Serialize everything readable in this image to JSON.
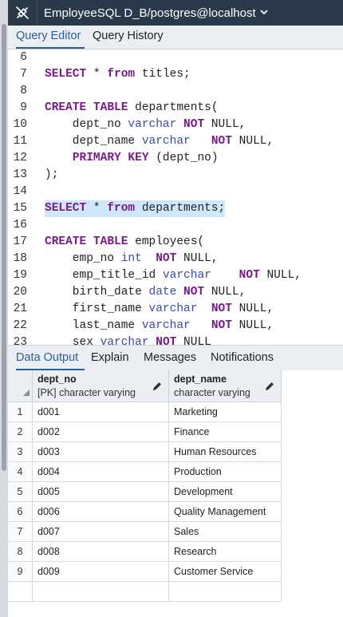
{
  "titlebar": {
    "title": "EmployeeSQL D_B/postgres@localhost",
    "connection_icon": "disconnected-plug-icon",
    "dropdown_icon": "chevron-down-icon"
  },
  "editor_tabs": [
    {
      "label": "Query Editor",
      "active": true
    },
    {
      "label": "Query History",
      "active": false
    }
  ],
  "editor": {
    "highlight_line": 15,
    "lines": [
      {
        "num": "6",
        "segs": []
      },
      {
        "num": "7",
        "segs": [
          [
            "kw",
            "SELECT"
          ],
          [
            "t",
            " * "
          ],
          [
            "kw",
            "from"
          ],
          [
            "t",
            " titles;"
          ]
        ]
      },
      {
        "num": "8",
        "segs": []
      },
      {
        "num": "9",
        "segs": [
          [
            "kw",
            "CREATE TABLE"
          ],
          [
            "t",
            " departments("
          ]
        ]
      },
      {
        "num": "10",
        "segs": [
          [
            "t",
            "    dept_no "
          ],
          [
            "ty",
            "varchar"
          ],
          [
            "t",
            " "
          ],
          [
            "kw",
            "NOT"
          ],
          [
            "t",
            " NULL,"
          ]
        ]
      },
      {
        "num": "11",
        "segs": [
          [
            "t",
            "    dept_name "
          ],
          [
            "ty",
            "varchar"
          ],
          [
            "t",
            "   "
          ],
          [
            "kw",
            "NOT"
          ],
          [
            "t",
            " NULL,"
          ]
        ]
      },
      {
        "num": "12",
        "segs": [
          [
            "t",
            "    "
          ],
          [
            "kw",
            "PRIMARY KEY"
          ],
          [
            "t",
            " (dept_no)"
          ]
        ]
      },
      {
        "num": "13",
        "segs": [
          [
            "t",
            ");"
          ]
        ]
      },
      {
        "num": "14",
        "segs": []
      },
      {
        "num": "15",
        "segs": [
          [
            "kw",
            "SELECT"
          ],
          [
            "t",
            " * "
          ],
          [
            "kw",
            "from"
          ],
          [
            "t",
            " departments;"
          ]
        ]
      },
      {
        "num": "16",
        "segs": []
      },
      {
        "num": "17",
        "segs": [
          [
            "kw",
            "CREATE TABLE"
          ],
          [
            "t",
            " employees("
          ]
        ]
      },
      {
        "num": "18",
        "segs": [
          [
            "t",
            "    emp_no "
          ],
          [
            "ty",
            "int"
          ],
          [
            "t",
            "  "
          ],
          [
            "kw",
            "NOT"
          ],
          [
            "t",
            " NULL,"
          ]
        ]
      },
      {
        "num": "19",
        "segs": [
          [
            "t",
            "    emp_title_id "
          ],
          [
            "ty",
            "varchar"
          ],
          [
            "t",
            "    "
          ],
          [
            "kw",
            "NOT"
          ],
          [
            "t",
            " NULL,"
          ]
        ]
      },
      {
        "num": "20",
        "segs": [
          [
            "t",
            "    birth_date "
          ],
          [
            "ty",
            "date"
          ],
          [
            "t",
            " "
          ],
          [
            "kw",
            "NOT"
          ],
          [
            "t",
            " NULL,"
          ]
        ]
      },
      {
        "num": "21",
        "segs": [
          [
            "t",
            "    first_name "
          ],
          [
            "ty",
            "varchar"
          ],
          [
            "t",
            "  "
          ],
          [
            "kw",
            "NOT"
          ],
          [
            "t",
            " NULL,"
          ]
        ]
      },
      {
        "num": "22",
        "segs": [
          [
            "t",
            "    last_name "
          ],
          [
            "ty",
            "varchar"
          ],
          [
            "t",
            "   "
          ],
          [
            "kw",
            "NOT"
          ],
          [
            "t",
            " NULL,"
          ]
        ]
      },
      {
        "num": "23",
        "segs": [
          [
            "t",
            "    sex "
          ],
          [
            "ty",
            "varchar"
          ],
          [
            "t",
            " "
          ],
          [
            "kw",
            "NOT"
          ],
          [
            "t",
            " NULL"
          ]
        ]
      }
    ]
  },
  "output_tabs": [
    {
      "label": "Data Output",
      "active": true
    },
    {
      "label": "Explain",
      "active": false
    },
    {
      "label": "Messages",
      "active": false
    },
    {
      "label": "Notifications",
      "active": false
    }
  ],
  "grid": {
    "columns": [
      {
        "name": "dept_no",
        "type": "[PK] character varying",
        "edit_icon": "pencil-icon"
      },
      {
        "name": "dept_name",
        "type": "character varying",
        "edit_icon": "pencil-icon"
      }
    ],
    "rows": [
      [
        "1",
        "d001",
        "Marketing"
      ],
      [
        "2",
        "d002",
        "Finance"
      ],
      [
        "3",
        "d003",
        "Human Resources"
      ],
      [
        "4",
        "d004",
        "Production"
      ],
      [
        "5",
        "d005",
        "Development"
      ],
      [
        "6",
        "d006",
        "Quality Management"
      ],
      [
        "7",
        "d007",
        "Sales"
      ],
      [
        "8",
        "d008",
        "Research"
      ],
      [
        "9",
        "d009",
        "Customer Service"
      ]
    ]
  },
  "colors": {
    "titlebar_bg": "#2b3a4a",
    "accent": "#2c5e9a",
    "keyword": "#7a1a8a",
    "type": "#3b4aa8",
    "highlight": "#cfe8f7"
  }
}
